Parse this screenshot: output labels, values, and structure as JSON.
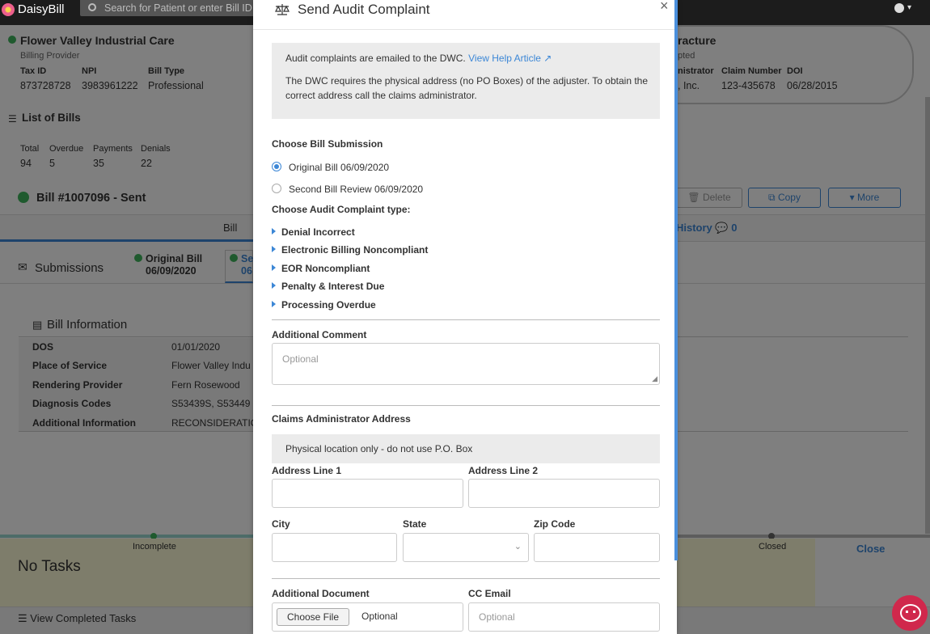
{
  "app": {
    "name": "DaisyBill",
    "search_placeholder": "Search for Patient or enter Bill ID"
  },
  "provider": {
    "name": "Flower Valley Industrial Care",
    "role": "Billing Provider",
    "fields": [
      {
        "label": "Tax ID",
        "value": "873728728"
      },
      {
        "label": "NPI",
        "value": "3983961222"
      },
      {
        "label": "Bill Type",
        "value": "Professional"
      }
    ]
  },
  "claim": {
    "title_fragment": "racture",
    "status_fragment": "pted",
    "admin_label_fragment": "nistrator",
    "admin_value_fragment": ", Inc.",
    "claim_number_label": "Claim Number",
    "claim_number": "123-435678",
    "doi_label": "DOI",
    "doi": "06/28/2015"
  },
  "list_of_bills": {
    "title": "List of Bills",
    "stats": [
      {
        "label": "Total",
        "value": "94"
      },
      {
        "label": "Overdue",
        "value": "5"
      },
      {
        "label": "Payments",
        "value": "35"
      },
      {
        "label": "Denials",
        "value": "22"
      }
    ]
  },
  "bill": {
    "title": "Bill #1007096 - Sent",
    "actions": {
      "delete": "Delete",
      "copy": "Copy",
      "more": "More"
    },
    "tab_bill": "Bill",
    "tab_history": "History",
    "history_count": "0"
  },
  "submissions": {
    "title": "Submissions",
    "items": [
      {
        "label": "Original Bill",
        "date": "06/09/2020"
      },
      {
        "label": "Se",
        "date": "06"
      }
    ]
  },
  "bill_info": {
    "title": "Bill Information",
    "rows": [
      {
        "label": "DOS",
        "value": "01/01/2020"
      },
      {
        "label": "Place of Service",
        "value": "Flower Valley Indu"
      },
      {
        "label": "Rendering Provider",
        "value": "Fern Rosewood"
      },
      {
        "label": "Diagnosis Codes",
        "value": "S53439S, S53449"
      },
      {
        "label": "Additional Information",
        "value": "RECONSIDERATIO"
      }
    ]
  },
  "tasks": {
    "incomplete": "Incomplete",
    "closed": "Closed",
    "none": "No Tasks",
    "close": "Close",
    "view_completed": "View Completed Tasks"
  },
  "modal": {
    "title": "Send Audit Complaint",
    "close": "×",
    "info_line1": "Audit complaints are emailed to the DWC.",
    "help_link": "View Help Article",
    "info_line2": "The DWC requires the physical address (no PO Boxes) of the adjuster. To obtain the correct address call the claims administrator.",
    "choose_submission": "Choose Bill Submission",
    "submissions": [
      {
        "label": "Original Bill 06/09/2020",
        "selected": true
      },
      {
        "label": "Second Bill Review 06/09/2020",
        "selected": false
      }
    ],
    "choose_type": "Choose Audit Complaint type:",
    "types": [
      "Denial Incorrect",
      "Electronic Billing Noncompliant",
      "EOR Noncompliant",
      "Penalty & Interest Due",
      "Processing Overdue"
    ],
    "additional_comment": "Additional Comment",
    "comment_placeholder": "Optional",
    "address_title": "Claims Administrator Address",
    "address_note": "Physical location only - do not use P.O. Box",
    "address_line1": "Address Line 1",
    "address_line2": "Address Line 2",
    "city": "City",
    "state": "State",
    "zip": "Zip Code",
    "additional_document": "Additional Document",
    "choose_file": "Choose File",
    "file_placeholder": "Optional",
    "cc_email": "CC Email",
    "cc_placeholder": "Optional"
  },
  "colors": {
    "accent": "#3c87d6",
    "success": "#3fb55d",
    "chat": "#d0284c"
  }
}
